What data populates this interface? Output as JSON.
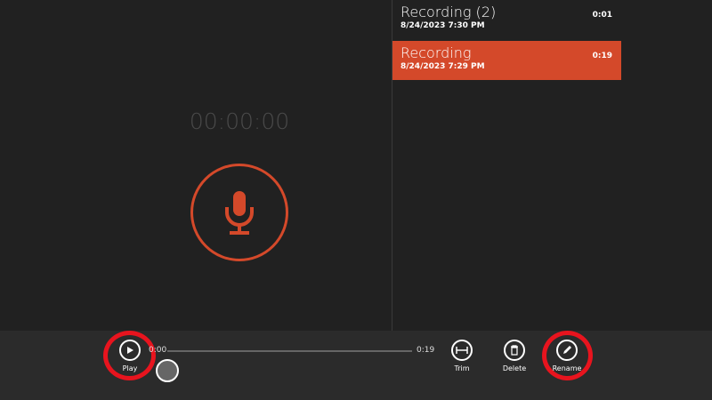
{
  "timer": "00:00:00",
  "recordings": [
    {
      "title": "Recording (2)",
      "date": "8/24/2023 7:30 PM",
      "duration": "0:01",
      "selected": false
    },
    {
      "title": "Recording",
      "date": "8/24/2023 7:29 PM",
      "duration": "0:19",
      "selected": true
    }
  ],
  "player": {
    "start": "0:00",
    "end": "0:19",
    "position": 0
  },
  "toolbar": {
    "play": "Play",
    "trim": "Trim",
    "delete": "Delete",
    "rename": "Rename"
  },
  "colors": {
    "accent": "#d4492a",
    "highlight": "#e8141e"
  }
}
